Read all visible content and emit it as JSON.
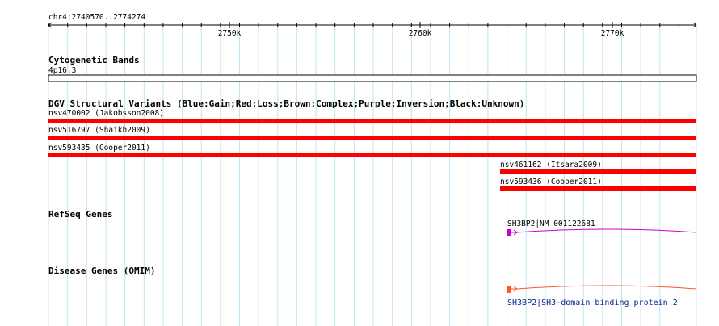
{
  "ruler": {
    "location": "chr4:2740570..2774274",
    "ticks": [
      "2750k",
      "2760k",
      "2770k"
    ]
  },
  "tracks": {
    "cytoband": {
      "title": "Cytogenetic Bands",
      "band_label": "4p16.3"
    },
    "dgv": {
      "title": "DGV Structural Variants (Blue:Gain;Red:Loss;Brown:Complex;Purple:Inversion;Black:Unknown)",
      "variants": [
        {
          "label": "nsv470002 (Jakobsson2008)",
          "color": "#ff0000"
        },
        {
          "label": "nsv516797 (Shaikh2009)",
          "color": "#ff0000"
        },
        {
          "label": "nsv593435 (Cooper2011)",
          "color": "#ff0000"
        },
        {
          "label": "nsv461162 (Itsara2009)",
          "color": "#ff0000"
        },
        {
          "label": "nsv593436 (Cooper2011)",
          "color": "#ff0000"
        }
      ]
    },
    "refseq": {
      "title": "RefSeq Genes",
      "gene_label": "SH3BP2|NM_001122681",
      "color": "#cc00cc"
    },
    "omim": {
      "title": "Disease Genes (OMIM)",
      "gene_label": "SH3BP2|SH3-domain binding protein 2",
      "color": "#ff5533"
    }
  },
  "colors": {
    "grid": "#bfe4f2",
    "loss": "#ff0000",
    "refseq": "#cc00cc",
    "omim": "#ff5533"
  }
}
